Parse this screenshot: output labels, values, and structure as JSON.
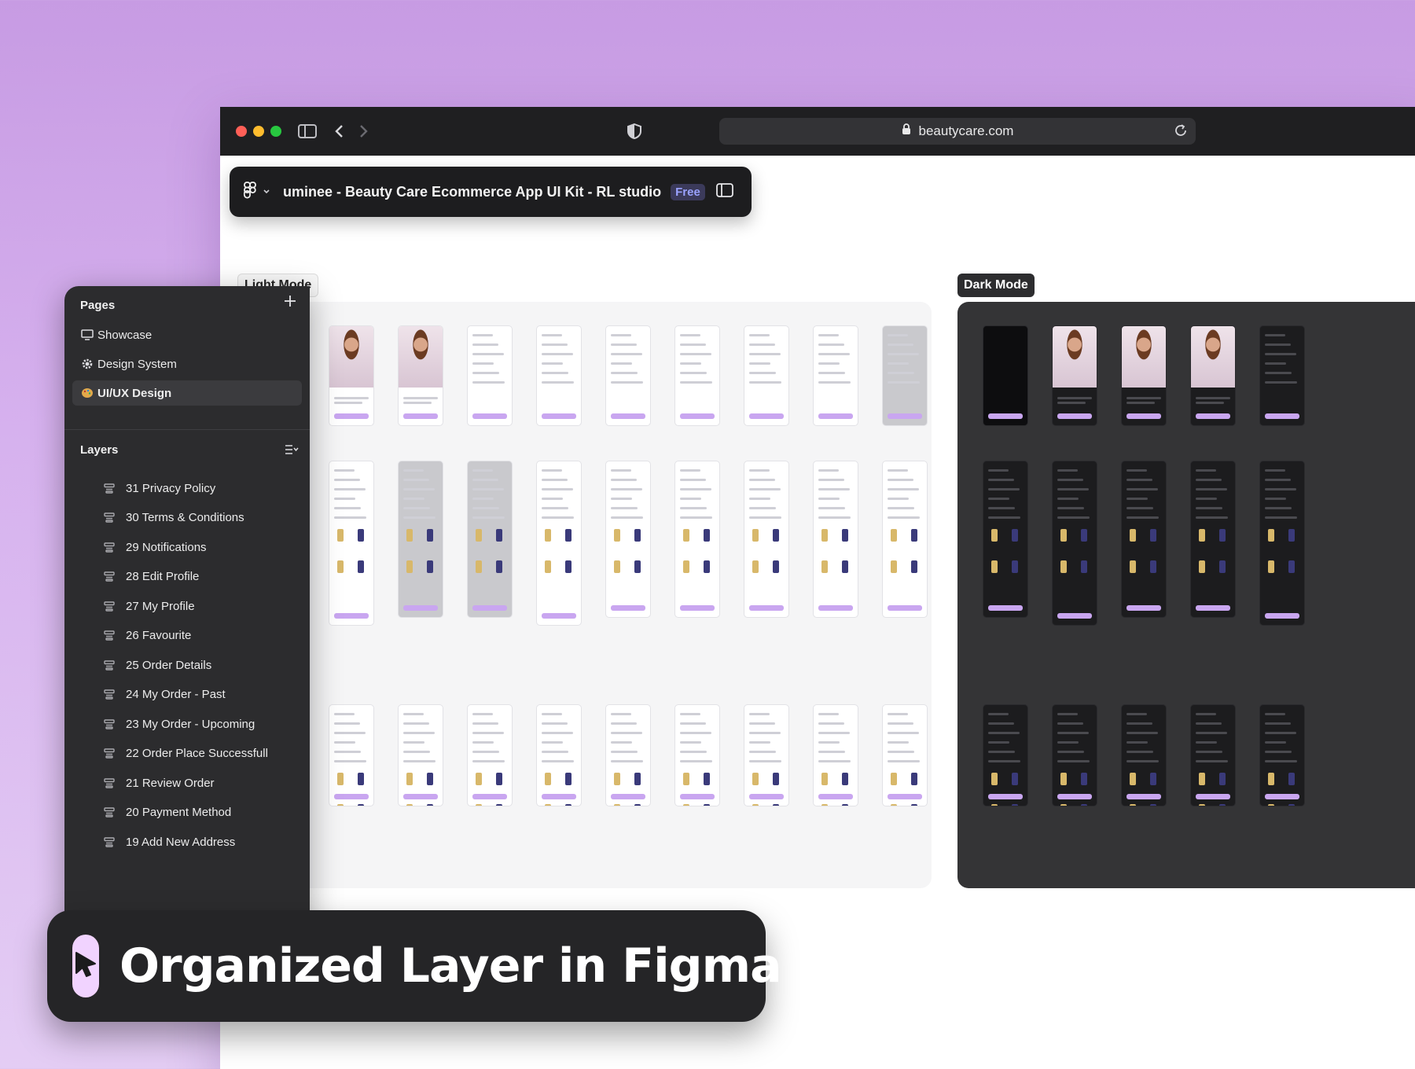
{
  "browser": {
    "url": "beautycare.com",
    "traffic_colors": [
      "#ff5f57",
      "#febc2e",
      "#28c840"
    ]
  },
  "figma": {
    "file_title": "uminee - Beauty Care Ecommerce App UI Kit - RL studio",
    "badge": "Free"
  },
  "canvas": {
    "light_label": "Light Mode",
    "dark_label": "Dark Mode",
    "accent": "#c9a6f0"
  },
  "pages": {
    "title": "Pages",
    "items": [
      {
        "label": "Showcase",
        "icon": "monitor-icon"
      },
      {
        "label": "Design System",
        "icon": "gear-icon"
      },
      {
        "label": "UI/UX Design",
        "icon": "palette-icon"
      }
    ]
  },
  "layers": {
    "title": "Layers",
    "items": [
      "31 Privacy Policy",
      "30 Terms & Conditions",
      "29 Notifications",
      "28 Edit Profile",
      "27 My Profile",
      "26 Favourite",
      "25 Order Details",
      "24 My Order - Past",
      "23 My Order - Upcoming",
      "22 Order Place Successfull",
      "21 Review Order",
      "20 Payment Method",
      "19 Add New Address"
    ]
  },
  "caption": {
    "text": "Organized Layer in Figma",
    "badge_color": "#f1d3ff"
  }
}
